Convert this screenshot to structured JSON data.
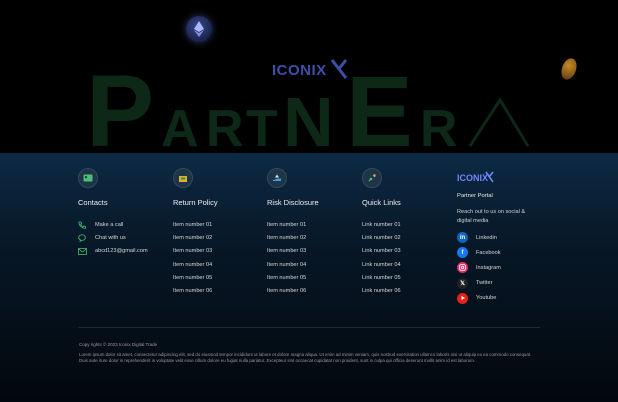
{
  "hero": {
    "word": "PARTNER",
    "brand": "ICONIX"
  },
  "columns": [
    {
      "id": "contacts",
      "title": "Contacts",
      "icon": "contact-card-icon",
      "items": [
        "Make a call",
        "Chat with us",
        "abcd123@gmail.com"
      ]
    },
    {
      "id": "return-policy",
      "title": "Return Policy",
      "icon": "return-box-icon",
      "items": [
        "Item number 01",
        "Item number 02",
        "Item number 03",
        "Item number 04",
        "Item number 05",
        "Item number 06"
      ]
    },
    {
      "id": "risk-disclosure",
      "title": "Risk Disclosure",
      "icon": "hand-warning-icon",
      "items": [
        "Item number 01",
        "Item number 02",
        "Item number 03",
        "Item number 04",
        "Item number 05",
        "Item number 06"
      ]
    },
    {
      "id": "quick-links",
      "title": "Quick Links",
      "icon": "link-icon",
      "items": [
        "Link number 01",
        "Link number 02",
        "Link number 03",
        "Link number 04",
        "Link number 05",
        "Link number 06"
      ]
    }
  ],
  "brand_column": {
    "logo": "ICONIX",
    "portal_title": "Partner Portal",
    "reach_text": "Reach out to us on social & digital media",
    "socials": [
      {
        "name": "Linkedin",
        "icon": "linkedin-icon",
        "color": "#0a66c2"
      },
      {
        "name": "Facebook",
        "icon": "facebook-icon",
        "color": "#1877f2"
      },
      {
        "name": "Instagram",
        "icon": "instagram-icon",
        "color": "#e1306c"
      },
      {
        "name": "Twitter",
        "icon": "x-twitter-icon",
        "color": "#222222"
      },
      {
        "name": "Youtube",
        "icon": "youtube-icon",
        "color": "#e62117"
      }
    ]
  },
  "footer": {
    "copyright": "Copy rights © 2023 Iconix Digital Trade",
    "lorem": "Lorem ipsum dolor sit amet, consectetur adipiscing elit, sed do eiusmod tempor incididunt ut labore et dolore magna aliqua. Ut enim ad minim veniam, quis nostrud exercitation ullamco laboris nisi ut aliquip ex ea commodo consequat. Duis aute irure dolor in reprehenderit in voluptate velit esse cillum dolore eu fugiat nulla pariatur. Excepteur sint occaecat cupidatat non proident, sunt in culpa qui officia deserunt mollit anim id est laborum."
  },
  "colors": {
    "accent_green": "#1e4a2c",
    "footer_top": "#0d2a45",
    "brand_blue": "#6f86ff"
  }
}
